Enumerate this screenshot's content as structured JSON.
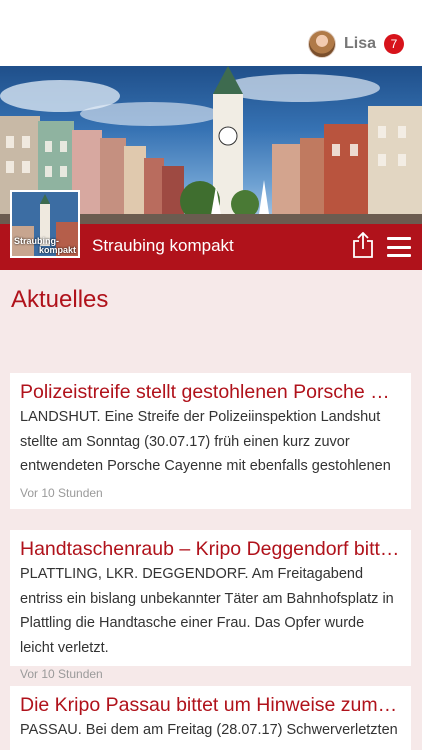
{
  "user": {
    "name": "Lisa",
    "notification_count": "7"
  },
  "header": {
    "title": "Straubing kompakt",
    "thumb_label_line1": "Straubing-",
    "thumb_label_line2": "kompakt"
  },
  "section": {
    "title": "Aktuelles"
  },
  "articles": [
    {
      "title": "Polizeistreife stellt gestohlenen Porsche Ca...",
      "text": "LANDSHUT. Eine Streife der Polizeiinspektion Landshut stellte am Sonntag (30.07.17) früh einen kurz zuvor entwendeten Porsche Cayenne mit ebenfalls gestohlenen",
      "time": "Vor 10 Stunden"
    },
    {
      "title": "Handtaschenraub – Kripo Deggendorf bitte...",
      "text": "PLATTLING, LKR. DEGGENDORF. Am Freitagabend entriss ein bislang unbekannter Täter am Bahnhofsplatz in Plattling die Handtasche einer Frau. Das Opfer wurde leicht verletzt.",
      "time": "Vor 10 Stunden"
    },
    {
      "title": "Die Kripo Passau bittet um Hinweise zum P...",
      "text": "PASSAU. Bei dem am Freitag (28.07.17) Schwerverletzten",
      "time": ""
    }
  ],
  "icons": {
    "share": "share-icon",
    "menu": "hamburger-menu-icon",
    "avatar": "avatar"
  },
  "colors": {
    "brand": "#b0121b",
    "background": "#f6e9e9",
    "badge": "#d7131b"
  }
}
